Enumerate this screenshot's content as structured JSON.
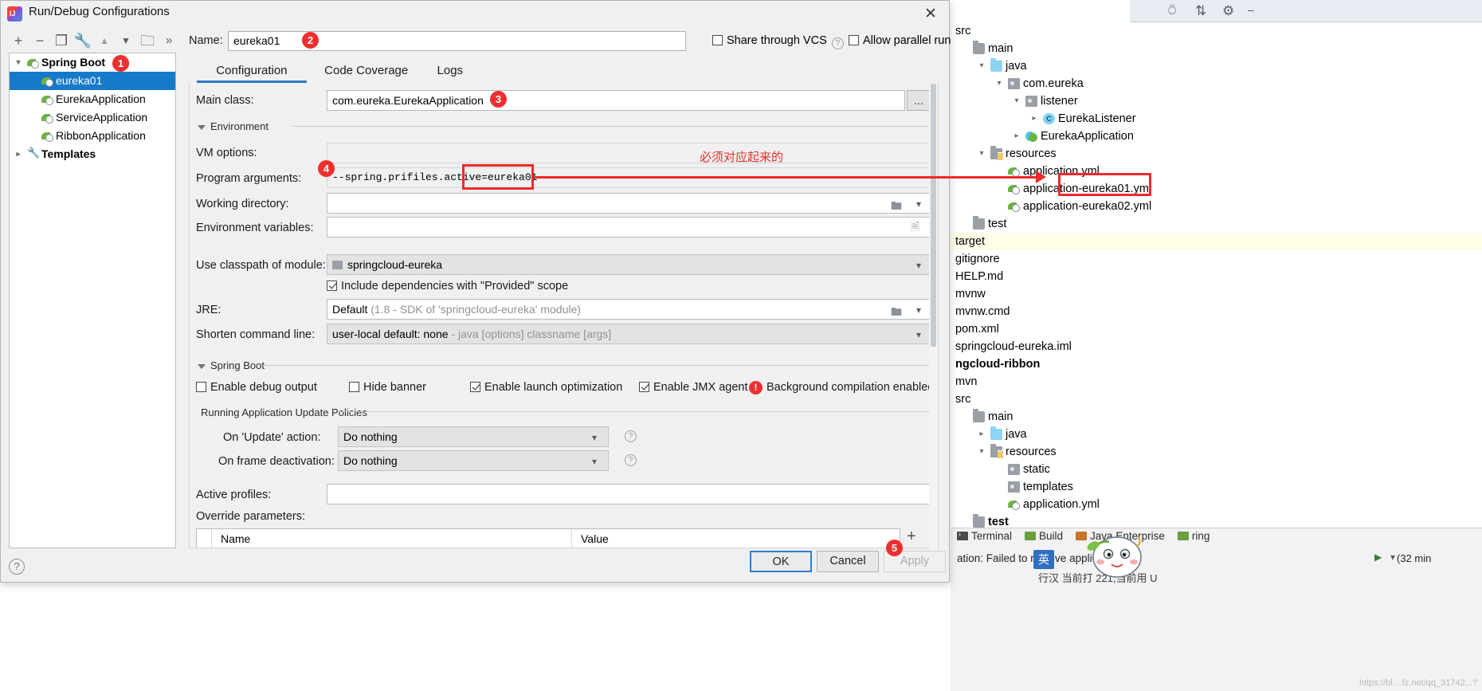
{
  "dialog": {
    "title": "Run/Debug Configurations",
    "close_icon": "close-icon",
    "toolbar": [
      {
        "name": "add-configuration-button",
        "glyph": "+"
      },
      {
        "name": "remove-configuration-button",
        "glyph": "−"
      },
      {
        "name": "copy-configuration-button",
        "glyph": "❐"
      },
      {
        "name": "edit-templates-button",
        "glyph": "🔧"
      },
      {
        "name": "move-up-button",
        "glyph": "▲"
      },
      {
        "name": "move-down-button",
        "glyph": "▼"
      },
      {
        "name": "new-folder-button",
        "glyph": "🗀"
      },
      {
        "name": "more-options-button",
        "glyph": "»"
      }
    ],
    "help_button": "?"
  },
  "config_tree": [
    {
      "label": "Spring Boot",
      "level": 0,
      "icon": "spring-boot-icon",
      "expanded": true,
      "bold": true,
      "selected": false
    },
    {
      "label": "eureka01",
      "level": 1,
      "icon": "spring-boot-icon",
      "expanded": false,
      "bold": false,
      "selected": true
    },
    {
      "label": "EurekaApplication",
      "level": 1,
      "icon": "spring-boot-icon",
      "expanded": false,
      "bold": false,
      "selected": false
    },
    {
      "label": "ServiceApplication",
      "level": 1,
      "icon": "spring-boot-icon",
      "expanded": false,
      "bold": false,
      "selected": false
    },
    {
      "label": "RibbonApplication",
      "level": 1,
      "icon": "spring-boot-icon",
      "expanded": false,
      "bold": false,
      "selected": false
    },
    {
      "label": "Templates",
      "level": 0,
      "icon": "wrench-icon",
      "expanded": false,
      "bold": true,
      "selected": false
    }
  ],
  "header": {
    "name_label": "Name:",
    "name_value": "eureka01",
    "share_vcs_label": "Share through VCS",
    "share_vcs_checked": false,
    "allow_parallel_label": "Allow parallel run",
    "allow_parallel_checked": false
  },
  "tabs": [
    {
      "label": "Configuration",
      "active": true
    },
    {
      "label": "Code Coverage",
      "active": false
    },
    {
      "label": "Logs",
      "active": false
    }
  ],
  "form": {
    "main_class_label": "Main class:",
    "main_class_value": "com.eureka.EurekaApplication",
    "browse_button": "...",
    "environment_section": "Environment",
    "vm_options_label": "VM options:",
    "vm_options_value": "",
    "program_arguments_label": "Program arguments:",
    "program_arguments_value": "--spring.prifiles.active=eureka01",
    "working_directory_label": "Working directory:",
    "working_directory_value": "",
    "environment_variables_label": "Environment variables:",
    "environment_variables_value": "",
    "classpath_label": "Use classpath of module:",
    "classpath_value": "springcloud-eureka",
    "include_provided_label": "Include dependencies with \"Provided\" scope",
    "include_provided_checked": true,
    "jre_label": "JRE:",
    "jre_value": "Default",
    "jre_hint": "(1.8 - SDK of 'springcloud-eureka' module)",
    "shorten_label": "Shorten command line:",
    "shorten_value": "user-local default: none",
    "shorten_hint": "- java [options] classname [args]"
  },
  "spring_boot_section": {
    "title": "Spring Boot",
    "checkboxes": [
      {
        "label": "Enable debug output",
        "checked": false
      },
      {
        "label": "Hide banner",
        "checked": false
      },
      {
        "label": "Enable launch optimization",
        "checked": true
      },
      {
        "label": "Enable JMX agent",
        "checked": true
      }
    ],
    "warning_icon": "error-circle-icon",
    "warning_text": "Background compilation enabled"
  },
  "update_policies": {
    "title": "Running Application Update Policies",
    "on_update_label": "On 'Update' action:",
    "on_update_value": "Do nothing",
    "on_frame_label": "On frame deactivation:",
    "on_frame_value": "Do nothing"
  },
  "profiles": {
    "active_profiles_label": "Active profiles:",
    "active_profiles_value": "",
    "override_parameters_label": "Override parameters:",
    "table_columns": [
      "Name",
      "Value"
    ],
    "add_parameter_button": "+"
  },
  "footer": {
    "ok": "OK",
    "cancel": "Cancel",
    "apply": "Apply"
  },
  "annotations": [
    {
      "id": "1",
      "target": "spring-boot-config-group"
    },
    {
      "id": "2",
      "target": "name-input"
    },
    {
      "id": "3",
      "target": "main-class-input"
    },
    {
      "id": "4",
      "target": "program-arguments-input"
    },
    {
      "id": "5",
      "target": "ok-button"
    }
  ],
  "annotation_note": "必须对应起来的",
  "project_tree": [
    {
      "label": "src",
      "indent": 0,
      "arrow": "",
      "icon": "none",
      "highlight": false,
      "bold": false
    },
    {
      "label": "main",
      "indent": 1,
      "arrow": "",
      "icon": "folder-grey",
      "highlight": false,
      "bold": false
    },
    {
      "label": "java",
      "indent": 2,
      "arrow": "v",
      "icon": "folder-blue",
      "highlight": false,
      "bold": false
    },
    {
      "label": "com.eureka",
      "indent": 3,
      "arrow": "v",
      "icon": "folder-package",
      "highlight": false,
      "bold": false
    },
    {
      "label": "listener",
      "indent": 4,
      "arrow": "v",
      "icon": "folder-package",
      "highlight": false,
      "bold": false
    },
    {
      "label": "EurekaListener",
      "indent": 5,
      "arrow": ">",
      "icon": "class-icon",
      "highlight": false,
      "bold": false
    },
    {
      "label": "EurekaApplication",
      "indent": 4,
      "arrow": ">",
      "icon": "spring-boot-class-icon",
      "highlight": false,
      "bold": false
    },
    {
      "label": "resources",
      "indent": 2,
      "arrow": "v",
      "icon": "folder-resources",
      "highlight": false,
      "bold": false
    },
    {
      "label": "application.yml",
      "indent": 3,
      "arrow": "",
      "icon": "spring-yml-icon",
      "highlight": false,
      "bold": false
    },
    {
      "label": "application-eureka01.yml",
      "indent": 3,
      "arrow": "",
      "icon": "spring-yml-icon",
      "highlight": false,
      "bold": false
    },
    {
      "label": "application-eureka02.yml",
      "indent": 3,
      "arrow": "",
      "icon": "spring-yml-icon",
      "highlight": false,
      "bold": false
    },
    {
      "label": "test",
      "indent": 1,
      "arrow": "",
      "icon": "folder-grey",
      "highlight": false,
      "bold": false
    },
    {
      "label": "target",
      "indent": 0,
      "arrow": "",
      "icon": "none",
      "highlight": true,
      "bold": false
    },
    {
      "label": "gitignore",
      "indent": 0,
      "arrow": "",
      "icon": "none",
      "highlight": false,
      "bold": false
    },
    {
      "label": "HELP.md",
      "indent": 0,
      "arrow": "",
      "icon": "none",
      "highlight": false,
      "bold": false
    },
    {
      "label": "mvnw",
      "indent": 0,
      "arrow": "",
      "icon": "none",
      "highlight": false,
      "bold": false
    },
    {
      "label": "mvnw.cmd",
      "indent": 0,
      "arrow": "",
      "icon": "none",
      "highlight": false,
      "bold": false
    },
    {
      "label": "pom.xml",
      "indent": 0,
      "arrow": "",
      "icon": "none",
      "highlight": false,
      "bold": false
    },
    {
      "label": "springcloud-eureka.iml",
      "indent": 0,
      "arrow": "",
      "icon": "none",
      "highlight": false,
      "bold": false
    },
    {
      "label": "ngcloud-ribbon",
      "indent": 0,
      "arrow": "",
      "icon": "none",
      "highlight": false,
      "bold": true
    },
    {
      "label": "mvn",
      "indent": 0,
      "arrow": "",
      "icon": "none",
      "highlight": false,
      "bold": false
    },
    {
      "label": "src",
      "indent": 0,
      "arrow": "",
      "icon": "none",
      "highlight": false,
      "bold": false
    },
    {
      "label": "main",
      "indent": 1,
      "arrow": "",
      "icon": "folder-grey",
      "highlight": false,
      "bold": false
    },
    {
      "label": "java",
      "indent": 2,
      "arrow": ">",
      "icon": "folder-blue",
      "highlight": false,
      "bold": false
    },
    {
      "label": "resources",
      "indent": 2,
      "arrow": "v",
      "icon": "folder-resources",
      "highlight": false,
      "bold": false
    },
    {
      "label": "static",
      "indent": 3,
      "arrow": "",
      "icon": "folder-package",
      "highlight": false,
      "bold": false
    },
    {
      "label": "templates",
      "indent": 3,
      "arrow": "",
      "icon": "folder-package",
      "highlight": false,
      "bold": false
    },
    {
      "label": "application.yml",
      "indent": 3,
      "arrow": "",
      "icon": "spring-yml-icon",
      "highlight": false,
      "bold": false
    },
    {
      "label": "test",
      "indent": 1,
      "arrow": "",
      "icon": "folder-grey",
      "highlight": false,
      "bold": true
    }
  ],
  "ide_bottom": {
    "tool_tabs": [
      {
        "label": "Terminal",
        "icon": "terminal-icon"
      },
      {
        "label": "Build",
        "icon": "build-icon"
      },
      {
        "label": "Java Enterprise",
        "icon": "java-enterprise-icon"
      },
      {
        "label": "ring",
        "icon": "spring-icon"
      }
    ],
    "status_text": "ation: Failed to retrieve applic",
    "right_status": "(32 min",
    "play_icon": "play-icon",
    "ime_label": "英",
    "ime_sub": "行汉  当前打 221,当前用 U",
    "watermark": "https://bl        ...fz.net/qq_31742...?"
  },
  "ide_toolbar_icons": [
    {
      "name": "globe-icon",
      "glyph": "⊕"
    },
    {
      "name": "filter-icon",
      "glyph": "⇅"
    },
    {
      "name": "settings-gear-icon",
      "glyph": "⚙"
    },
    {
      "name": "minimize-icon",
      "glyph": "−"
    }
  ],
  "colors": {
    "accent": "#1779c9",
    "annotation_red": "#ef2a2a",
    "tab_underline": "#2d7cc4",
    "highlight_row": "#fffce8"
  }
}
